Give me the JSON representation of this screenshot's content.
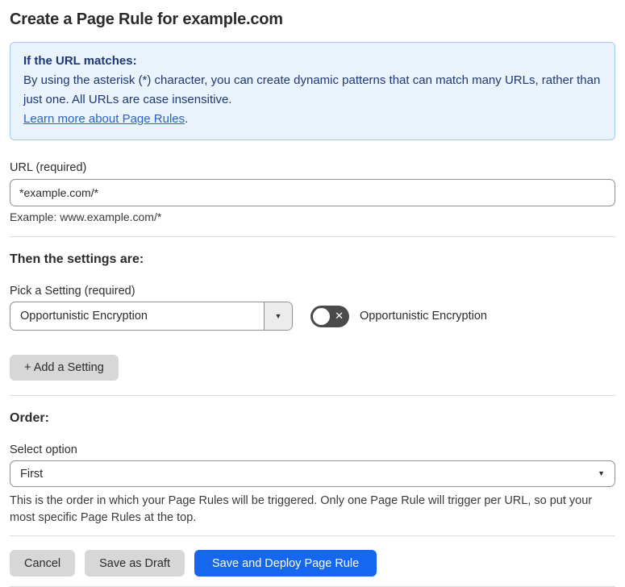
{
  "page": {
    "title": "Create a Page Rule for example.com"
  },
  "info_box": {
    "heading": "If the URL matches:",
    "body": "By using the asterisk (*) character, you can create dynamic patterns that can match many URLs, rather than just one. All URLs are case insensitive.",
    "link": "Learn more about Page Rules",
    "link_suffix": ".",
    "colors": {
      "background": "#eaf2fc",
      "border": "#a9c8ee",
      "text": "#1d3a70",
      "link": "#2a63c8"
    }
  },
  "url_field": {
    "label": "URL (required)",
    "value": "*example.com/*",
    "example": "Example: www.example.com/*"
  },
  "settings": {
    "heading": "Then the settings are:",
    "picker_label": "Pick a Setting (required)",
    "selected_setting": "Opportunistic Encryption",
    "toggle": {
      "state": "off",
      "label": "Opportunistic Encryption"
    },
    "add_button_label": "+ Add a Setting"
  },
  "order": {
    "heading": "Order:",
    "label": "Select option",
    "selected_option": "First",
    "help": "This is the order in which your Page Rules will be triggered. Only one Page Rule will trigger per URL, so put your most specific Page Rules at the top."
  },
  "actions": {
    "cancel": "Cancel",
    "save_draft": "Save as Draft",
    "save_deploy": "Save and Deploy Page Rule",
    "primary_color": "#1567ef"
  },
  "icons": {
    "toggle_off_x": "✕",
    "caret_down": "▼"
  }
}
